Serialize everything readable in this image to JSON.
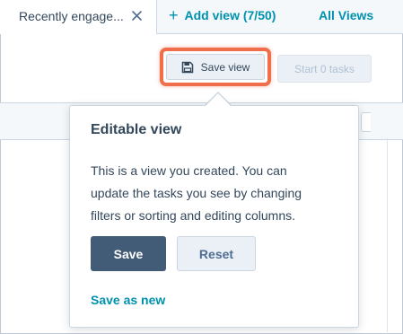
{
  "tabs": {
    "active_tab_label": "Recently engage...",
    "add_view_label": "Add view (7/50)",
    "all_views_label": "All Views"
  },
  "toolbar": {
    "save_view_label": "Save view",
    "start_tasks_label": "Start 0 tasks"
  },
  "popover": {
    "title": "Editable view",
    "body_lines": [
      "This is a view you created. You can",
      "update the tasks you see by changing",
      "filters or sorting and editing columns."
    ],
    "save_label": "Save",
    "reset_label": "Reset",
    "save_as_new_label": "Save as new"
  },
  "colors": {
    "highlight": "#f06e4c",
    "link": "#0091ae",
    "primary_button": "#425b76"
  }
}
